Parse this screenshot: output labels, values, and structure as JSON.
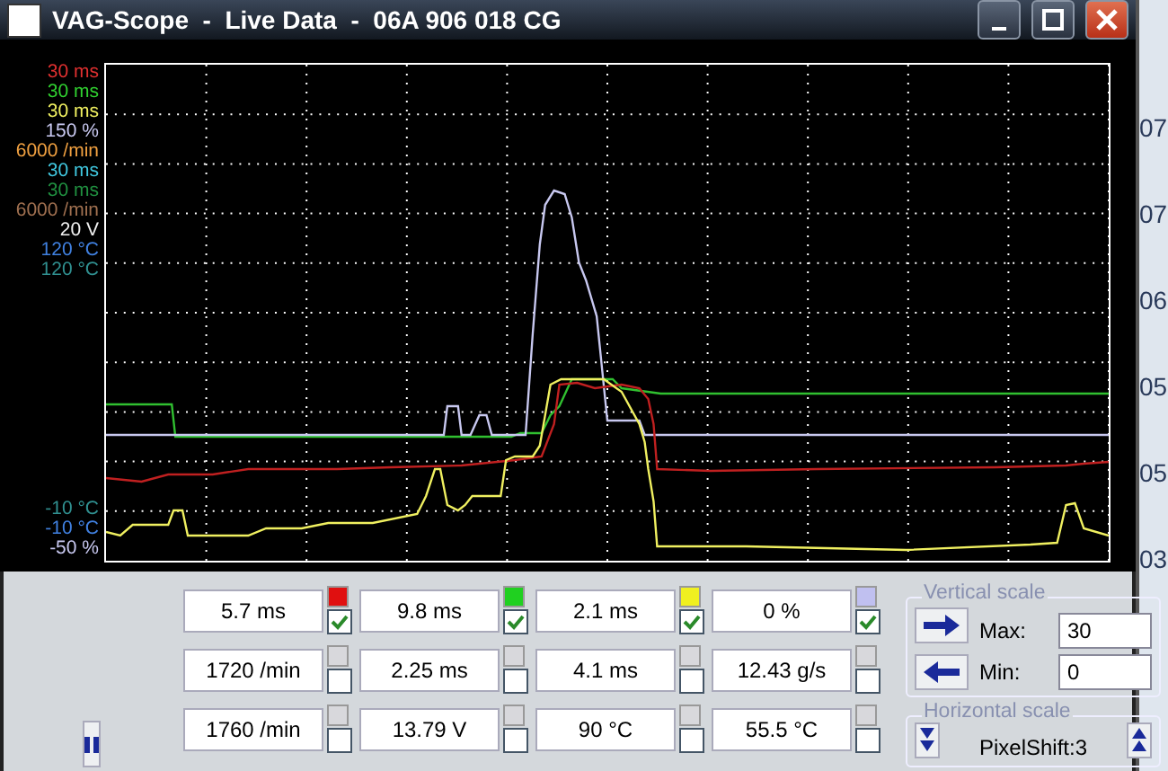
{
  "window": {
    "title": "VAG-Scope  -  Live Data  -  06A 906 018 CG"
  },
  "scale_top": [
    {
      "text": "30 ms",
      "color": "#e03030"
    },
    {
      "text": "30 ms",
      "color": "#30d030"
    },
    {
      "text": "30 ms",
      "color": "#f0f060"
    },
    {
      "text": "150 %",
      "color": "#c8c8f0"
    },
    {
      "text": "6000 /min",
      "color": "#f0a040"
    },
    {
      "text": "30 ms",
      "color": "#40c8e0"
    },
    {
      "text": "30 ms",
      "color": "#209040"
    },
    {
      "text": "6000 /min",
      "color": "#a07050"
    },
    {
      "text": "20 V",
      "color": "#f0f0f0"
    },
    {
      "text": "120 °C",
      "color": "#4080e0"
    },
    {
      "text": "120 °C",
      "color": "#309090"
    }
  ],
  "scale_bottom": [
    {
      "text": "-10 °C",
      "color": "#309090"
    },
    {
      "text": "-10 °C",
      "color": "#4080e0"
    },
    {
      "text": "-50 %",
      "color": "#c8c8f0"
    }
  ],
  "channels": [
    {
      "value": "5.7 ms",
      "color": "#e01010",
      "checked": true
    },
    {
      "value": "9.8 ms",
      "color": "#20d020",
      "checked": true
    },
    {
      "value": "2.1 ms",
      "color": "#f0f020",
      "checked": true
    },
    {
      "value": "0 %",
      "color": "#c0c0f0",
      "checked": true
    },
    {
      "value": "1720 /min",
      "checked": false
    },
    {
      "value": "2.25 ms",
      "checked": false
    },
    {
      "value": "4.1 ms",
      "checked": false
    },
    {
      "value": "12.43 g/s",
      "checked": false
    },
    {
      "value": "1760 /min",
      "checked": false
    },
    {
      "value": "13.79 V",
      "checked": false
    },
    {
      "value": "90 °C",
      "checked": false
    },
    {
      "value": "55.5 °C",
      "checked": false
    }
  ],
  "vertical_scale": {
    "title": "Vertical scale",
    "max_label": "Max:",
    "max_value": "30",
    "min_label": "Min:",
    "min_value": "0"
  },
  "horizontal_scale": {
    "title": "Horizontal scale",
    "value": "PixelShift:3"
  },
  "background_app": [
    "07",
    "07",
    "06",
    "05",
    "05",
    "03"
  ]
}
